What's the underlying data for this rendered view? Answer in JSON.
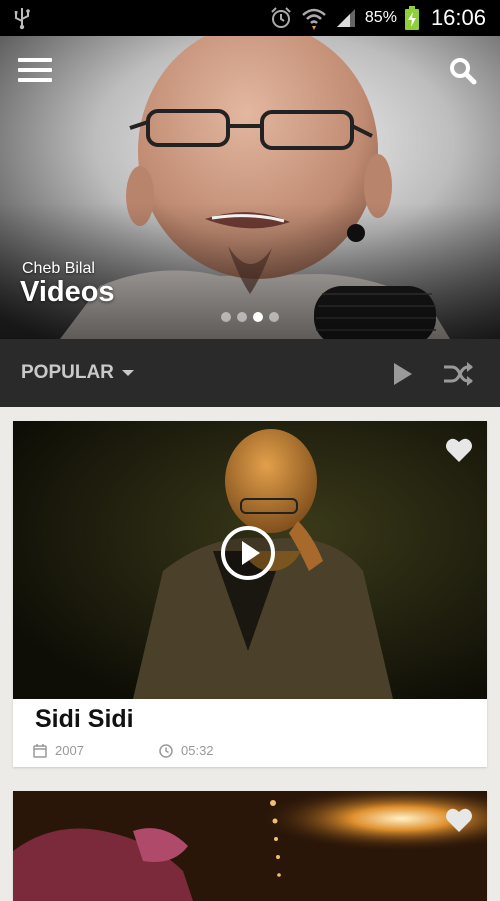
{
  "status_bar": {
    "battery": "85%",
    "time": "16:06"
  },
  "hero": {
    "subtitle": "Cheb Bilal",
    "title": "Videos",
    "slide_count": 4,
    "active_slide": 3
  },
  "filter": {
    "sort_label": "POPULAR"
  },
  "videos": [
    {
      "title": "Sidi Sidi",
      "year": "2007",
      "duration": "05:32"
    },
    {
      "title": ""
    }
  ],
  "colors": {
    "filter_bar": "#2a2a2a",
    "background": "#ecebe7"
  }
}
